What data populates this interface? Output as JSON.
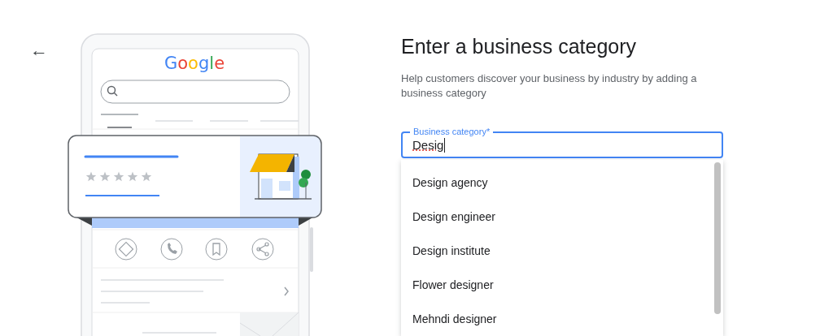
{
  "back_button": {
    "label": "←"
  },
  "illustration": {
    "logo_text": "Google"
  },
  "heading": "Enter a business category",
  "description": "Help customers discover your business by industry by adding a business category",
  "field": {
    "label": "Business category*",
    "value": "Desig",
    "focused": true,
    "spellcheck_flagged": true
  },
  "suggestions": [
    {
      "label": "Design agency",
      "selected": false
    },
    {
      "label": "Design engineer",
      "selected": false
    },
    {
      "label": "Design institute",
      "selected": false
    },
    {
      "label": "Flower designer",
      "selected": false
    },
    {
      "label": "Mehndi designer",
      "selected": false
    }
  ]
}
